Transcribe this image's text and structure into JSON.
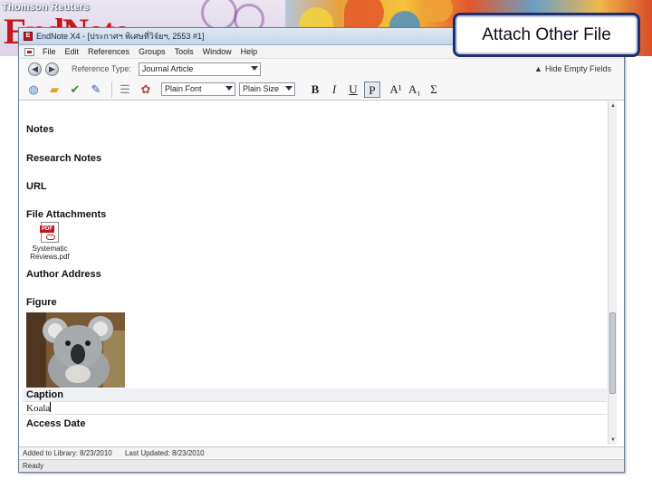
{
  "banner": {
    "company": "Thomson Reuters",
    "logo": "EndNote"
  },
  "callout": {
    "text": "Attach Other File"
  },
  "window": {
    "title": "EndNote X4 - [ประกาศฯ พิเศษที่วิจัยฯ, 2553 #1]",
    "menu": [
      "File",
      "Edit",
      "References",
      "Groups",
      "Tools",
      "Window",
      "Help"
    ],
    "reference_type_label": "Reference Type:",
    "reference_type_value": "Journal Article",
    "hide_empty_label": "Hide Empty Fields",
    "font_value": "Plain Font",
    "size_value": "Plain Size",
    "format_buttons": [
      "B",
      "I",
      "U",
      "P",
      "A¹",
      "A₁",
      "Σ"
    ]
  },
  "fields": {
    "notes": "Notes",
    "research_notes": "Research Notes",
    "url": "URL",
    "file_attachments": "File Attachments",
    "attachment_name_line1": "Systematic",
    "attachment_name_line2": "Reviews.pdf",
    "pdf_tag": "PDF",
    "author_address": "Author Address",
    "figure": "Figure",
    "caption": "Caption",
    "caption_value": "Koala",
    "access_date": "Access Date"
  },
  "status": {
    "added": "Added to Library: 8/23/2010",
    "updated": "Last Updated: 8/23/2010",
    "ready": "Ready"
  }
}
